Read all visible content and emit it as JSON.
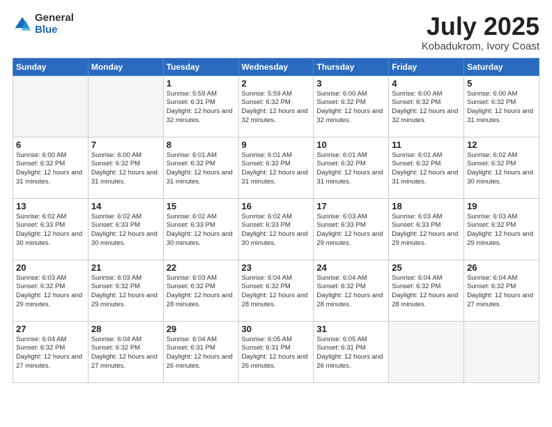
{
  "logo": {
    "general": "General",
    "blue": "Blue"
  },
  "title": "July 2025",
  "location": "Kobadukrom, Ivory Coast",
  "header": {
    "days": [
      "Sunday",
      "Monday",
      "Tuesday",
      "Wednesday",
      "Thursday",
      "Friday",
      "Saturday"
    ]
  },
  "weeks": [
    [
      {
        "day": "",
        "info": ""
      },
      {
        "day": "",
        "info": ""
      },
      {
        "day": "1",
        "info": "Sunrise: 5:59 AM\nSunset: 6:31 PM\nDaylight: 12 hours and 32 minutes."
      },
      {
        "day": "2",
        "info": "Sunrise: 5:59 AM\nSunset: 6:32 PM\nDaylight: 12 hours and 32 minutes."
      },
      {
        "day": "3",
        "info": "Sunrise: 6:00 AM\nSunset: 6:32 PM\nDaylight: 12 hours and 32 minutes."
      },
      {
        "day": "4",
        "info": "Sunrise: 6:00 AM\nSunset: 6:32 PM\nDaylight: 12 hours and 32 minutes."
      },
      {
        "day": "5",
        "info": "Sunrise: 6:00 AM\nSunset: 6:32 PM\nDaylight: 12 hours and 31 minutes."
      }
    ],
    [
      {
        "day": "6",
        "info": "Sunrise: 6:00 AM\nSunset: 6:32 PM\nDaylight: 12 hours and 31 minutes."
      },
      {
        "day": "7",
        "info": "Sunrise: 6:00 AM\nSunset: 6:32 PM\nDaylight: 12 hours and 31 minutes."
      },
      {
        "day": "8",
        "info": "Sunrise: 6:01 AM\nSunset: 6:32 PM\nDaylight: 12 hours and 31 minutes."
      },
      {
        "day": "9",
        "info": "Sunrise: 6:01 AM\nSunset: 6:32 PM\nDaylight: 12 hours and 31 minutes."
      },
      {
        "day": "10",
        "info": "Sunrise: 6:01 AM\nSunset: 6:32 PM\nDaylight: 12 hours and 31 minutes."
      },
      {
        "day": "11",
        "info": "Sunrise: 6:01 AM\nSunset: 6:32 PM\nDaylight: 12 hours and 31 minutes."
      },
      {
        "day": "12",
        "info": "Sunrise: 6:02 AM\nSunset: 6:32 PM\nDaylight: 12 hours and 30 minutes."
      }
    ],
    [
      {
        "day": "13",
        "info": "Sunrise: 6:02 AM\nSunset: 6:33 PM\nDaylight: 12 hours and 30 minutes."
      },
      {
        "day": "14",
        "info": "Sunrise: 6:02 AM\nSunset: 6:33 PM\nDaylight: 12 hours and 30 minutes."
      },
      {
        "day": "15",
        "info": "Sunrise: 6:02 AM\nSunset: 6:33 PM\nDaylight: 12 hours and 30 minutes."
      },
      {
        "day": "16",
        "info": "Sunrise: 6:02 AM\nSunset: 6:33 PM\nDaylight: 12 hours and 30 minutes."
      },
      {
        "day": "17",
        "info": "Sunrise: 6:03 AM\nSunset: 6:33 PM\nDaylight: 12 hours and 29 minutes."
      },
      {
        "day": "18",
        "info": "Sunrise: 6:03 AM\nSunset: 6:33 PM\nDaylight: 12 hours and 29 minutes."
      },
      {
        "day": "19",
        "info": "Sunrise: 6:03 AM\nSunset: 6:32 PM\nDaylight: 12 hours and 29 minutes."
      }
    ],
    [
      {
        "day": "20",
        "info": "Sunrise: 6:03 AM\nSunset: 6:32 PM\nDaylight: 12 hours and 29 minutes."
      },
      {
        "day": "21",
        "info": "Sunrise: 6:03 AM\nSunset: 6:32 PM\nDaylight: 12 hours and 29 minutes."
      },
      {
        "day": "22",
        "info": "Sunrise: 6:03 AM\nSunset: 6:32 PM\nDaylight: 12 hours and 28 minutes."
      },
      {
        "day": "23",
        "info": "Sunrise: 6:04 AM\nSunset: 6:32 PM\nDaylight: 12 hours and 28 minutes."
      },
      {
        "day": "24",
        "info": "Sunrise: 6:04 AM\nSunset: 6:32 PM\nDaylight: 12 hours and 28 minutes."
      },
      {
        "day": "25",
        "info": "Sunrise: 6:04 AM\nSunset: 6:32 PM\nDaylight: 12 hours and 28 minutes."
      },
      {
        "day": "26",
        "info": "Sunrise: 6:04 AM\nSunset: 6:32 PM\nDaylight: 12 hours and 27 minutes."
      }
    ],
    [
      {
        "day": "27",
        "info": "Sunrise: 6:04 AM\nSunset: 6:32 PM\nDaylight: 12 hours and 27 minutes."
      },
      {
        "day": "28",
        "info": "Sunrise: 6:04 AM\nSunset: 6:32 PM\nDaylight: 12 hours and 27 minutes."
      },
      {
        "day": "29",
        "info": "Sunrise: 6:04 AM\nSunset: 6:31 PM\nDaylight: 12 hours and 26 minutes."
      },
      {
        "day": "30",
        "info": "Sunrise: 6:05 AM\nSunset: 6:31 PM\nDaylight: 12 hours and 26 minutes."
      },
      {
        "day": "31",
        "info": "Sunrise: 6:05 AM\nSunset: 6:31 PM\nDaylight: 12 hours and 26 minutes."
      },
      {
        "day": "",
        "info": ""
      },
      {
        "day": "",
        "info": ""
      }
    ]
  ]
}
